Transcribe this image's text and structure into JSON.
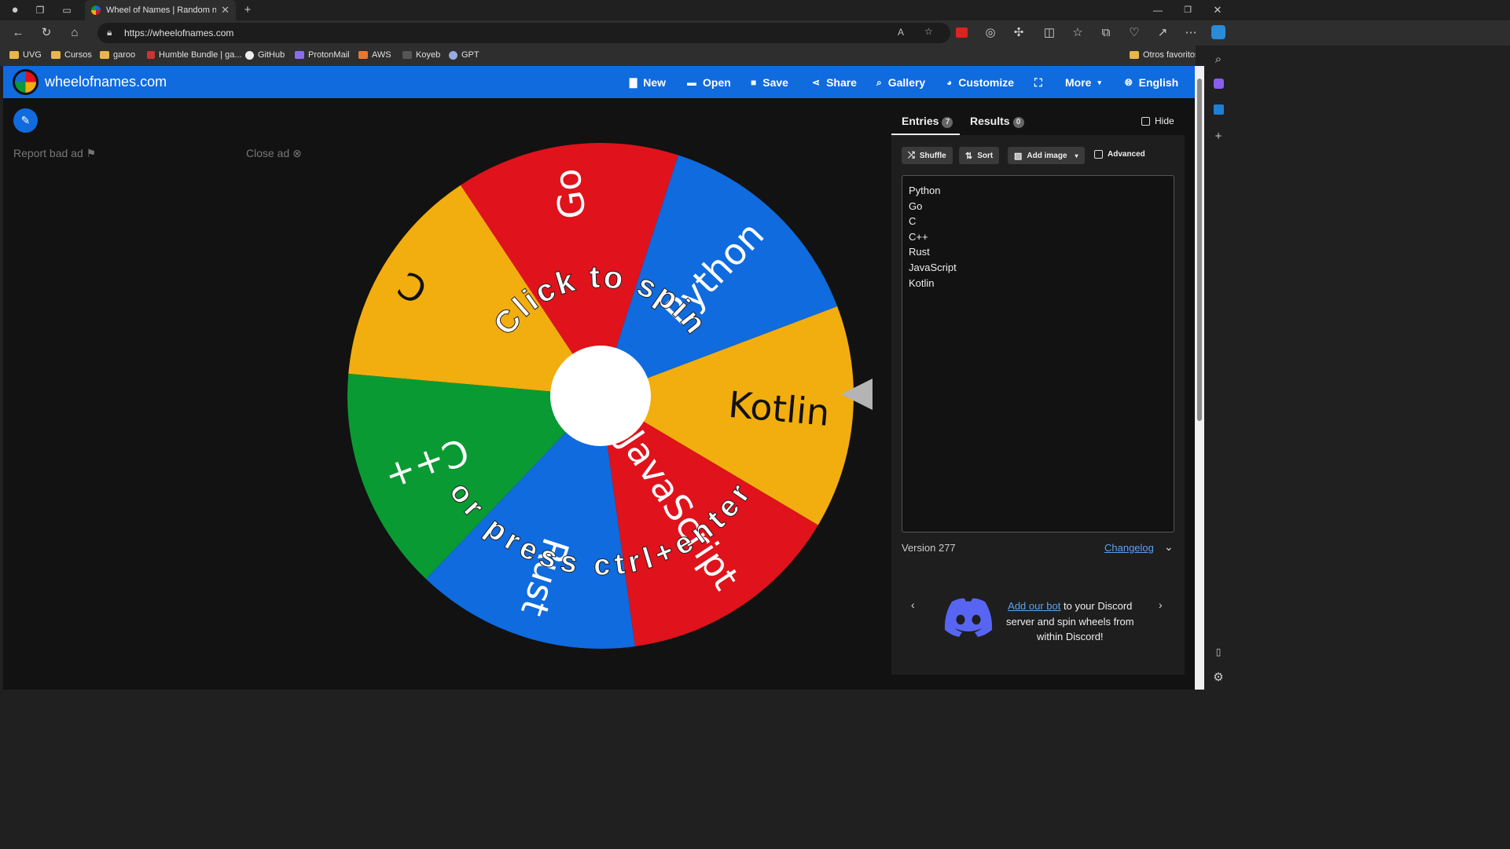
{
  "browser": {
    "tab_title": "Wheel of Names | Random name",
    "url": "https://wheelofnames.com",
    "bookmarks": [
      "UVG",
      "Cursos",
      "garoo",
      "Humble Bundle | ga...",
      "GitHub",
      "ProtonMail",
      "AWS",
      "Koyeb",
      "GPT"
    ],
    "other_bookmarks": "Otros favoritos"
  },
  "header": {
    "brand": "wheelofnames.com",
    "menu": [
      "New",
      "Open",
      "Save",
      "Share",
      "Gallery",
      "Customize",
      "More",
      "English"
    ]
  },
  "ads": {
    "report": "Report bad ad",
    "close": "Close ad"
  },
  "wheel": {
    "top_text": "Click to spin",
    "bottom_text": "or press ctrl+enter",
    "segments": [
      {
        "label": "Python",
        "color": "#0f6bde"
      },
      {
        "label": "Go",
        "color": "#e0121c"
      },
      {
        "label": "C",
        "color": "#f2ae0e"
      },
      {
        "label": "C++",
        "color": "#0a9a33"
      },
      {
        "label": "Rust",
        "color": "#0f6bde"
      },
      {
        "label": "JavaScript",
        "color": "#e0121c"
      },
      {
        "label": "Kotlin",
        "color": "#f2ae0e"
      }
    ]
  },
  "panel": {
    "tabs": [
      {
        "label": "Entries",
        "count": "7"
      },
      {
        "label": "Results",
        "count": "0"
      }
    ],
    "hide_label": "Hide",
    "toolbar": {
      "shuffle": "Shuffle",
      "sort": "Sort",
      "add_image": "Add image",
      "advanced": "Advanced"
    },
    "entries": [
      "Python",
      "Go",
      "C",
      "C++",
      "Rust",
      "JavaScript",
      "Kotlin"
    ],
    "version": "Version 277",
    "changelog": "Changelog",
    "discord": {
      "link": "Add our bot",
      "line1_rest": " to your Discord",
      "line2": "server and spin wheels from",
      "line3": "within Discord!"
    }
  }
}
